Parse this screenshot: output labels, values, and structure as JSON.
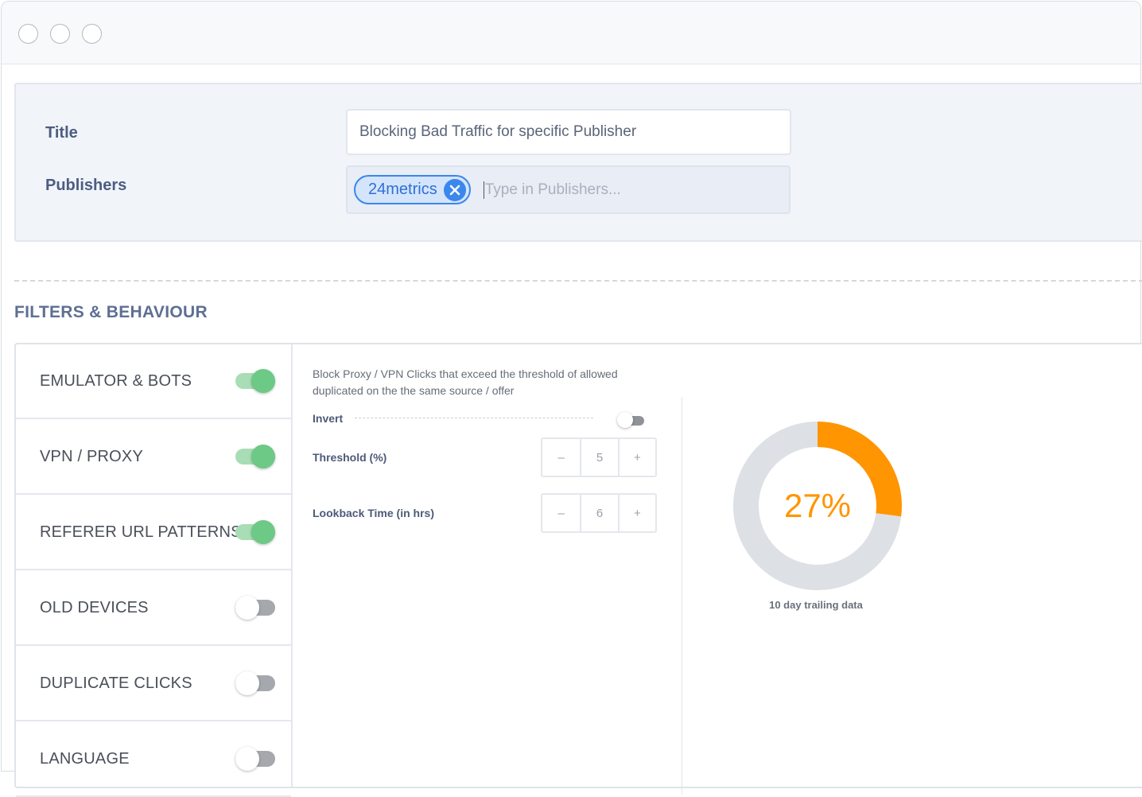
{
  "form": {
    "title_label": "Title",
    "title_value": "Blocking Bad Traffic for specific Publisher",
    "publishers_label": "Publishers",
    "publisher_chips": [
      "24metrics"
    ],
    "publishers_placeholder": "Type in Publishers..."
  },
  "section": {
    "title": "FILTERS & BEHAVIOUR"
  },
  "filters": [
    {
      "label": "EMULATOR & BOTS",
      "enabled": true
    },
    {
      "label": "VPN / PROXY",
      "enabled": true
    },
    {
      "label": "REFERER URL PATTERNS",
      "enabled": true
    },
    {
      "label": "OLD DEVICES",
      "enabled": false
    },
    {
      "label": "DUPLICATE CLICKS",
      "enabled": false
    },
    {
      "label": "LANGUAGE",
      "enabled": false
    }
  ],
  "detail": {
    "description": "Block Proxy / VPN Clicks that exceed the threshold of allowed duplicated on the the same source / offer",
    "invert_label": "Invert",
    "invert_enabled": false,
    "threshold_label": "Threshold (%)",
    "threshold_value": "5",
    "lookback_label": "Lookback Time (in hrs)",
    "lookback_value": "6",
    "minus": "–",
    "plus": "+"
  },
  "chart_data": {
    "type": "pie",
    "variant": "donut",
    "values": [
      27,
      73
    ],
    "colors": [
      "#ff9500",
      "#dde0e5"
    ],
    "center_label": "27%",
    "caption": "10 day trailing data"
  },
  "colors": {
    "accent_blue": "#3b87ec",
    "toggle_on": "#6cc986",
    "donut_orange": "#ff9500"
  }
}
